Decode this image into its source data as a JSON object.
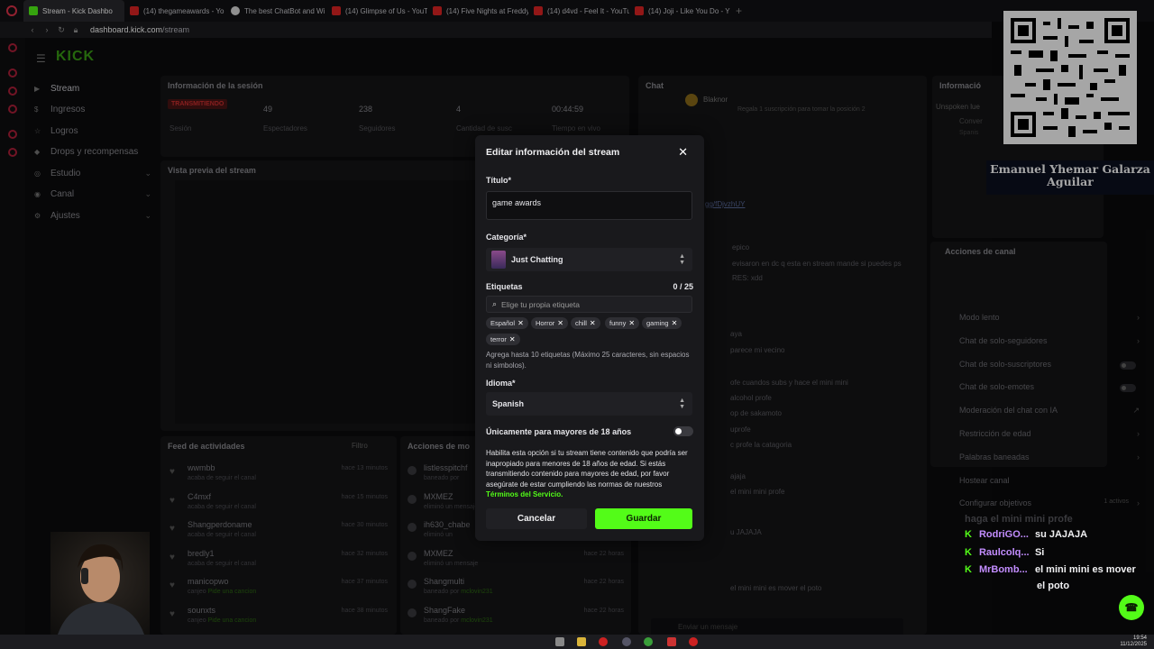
{
  "browser": {
    "tabs": [
      {
        "label": "Stream - Kick Dashbo",
        "icon": "kick",
        "active": true
      },
      {
        "label": "(14) thegameawards - Yo",
        "icon": "yt"
      },
      {
        "label": "The best ChatBot and Wi",
        "icon": "gpt"
      },
      {
        "label": "(14) Glimpse of Us - YouT",
        "icon": "yt"
      },
      {
        "label": "(14) Five Nights at Freddy",
        "icon": "yt"
      },
      {
        "label": "(14) d4vd - Feel It - YouTu",
        "icon": "yt"
      },
      {
        "label": "(14) Joji - Like You Do - Y",
        "icon": "yt"
      }
    ],
    "url_host": "dashboard.kick.com",
    "url_path": "/stream"
  },
  "sidebar": {
    "logo": "KICK",
    "items": [
      {
        "label": "Stream",
        "active": true
      },
      {
        "label": "Ingresos"
      },
      {
        "label": "Logros"
      },
      {
        "label": "Drops y recompensas"
      },
      {
        "label": "Estudio",
        "chevron": true
      },
      {
        "label": "Canal",
        "chevron": true
      },
      {
        "label": "Ajustes",
        "chevron": true
      }
    ]
  },
  "session": {
    "title": "Información de la sesión",
    "live_badge": "TRANSMITIENDO",
    "stats": [
      {
        "value": "",
        "label": "Sesión"
      },
      {
        "value": "49",
        "label": "Espectadores"
      },
      {
        "value": "238",
        "label": "Seguidores"
      },
      {
        "value": "4",
        "label": "Cantidad de susc"
      },
      {
        "value": "00:44:59",
        "label": "Tiempo en vivo"
      }
    ]
  },
  "preview": {
    "title": "Vista previa del stream"
  },
  "feed": {
    "title": "Feed de actividades",
    "filter": "Filtro",
    "rows": [
      {
        "name": "wwmbb",
        "sub": "acaba de seguir el canal",
        "time": "hace 13 minutos"
      },
      {
        "name": "C4mxf",
        "sub": "acaba de seguir el canal",
        "time": "hace 15 minutos"
      },
      {
        "name": "Shangperdoname",
        "sub": "acaba de seguir el canal",
        "time": "hace 30 minutos"
      },
      {
        "name": "bredly1",
        "sub": "acaba de seguir el canal",
        "time": "hace 32 minutos"
      },
      {
        "name": "manicopwo",
        "sub_prefix": "canjeo ",
        "sub_link": "Pide una cancion",
        "time": "hace 37 minutos"
      },
      {
        "name": "sounxts",
        "sub_prefix": "canjeo ",
        "sub_link": "Pide una cancion",
        "time": "hace 38 minutos"
      }
    ]
  },
  "mod_actions": {
    "title": "Acciones de mo",
    "rows": [
      {
        "name": "listlesspitchf",
        "sub_prefix": "baneado por ",
        "sub_link": "",
        "time": ""
      },
      {
        "name": "MXMEZ",
        "sub_prefix": "eliminó un mensaje",
        "sub_link": "",
        "time": ""
      },
      {
        "name": "ih630_chabe",
        "sub_prefix": "eliminó un ",
        "sub_link": "",
        "time": ""
      },
      {
        "name": "MXMEZ",
        "sub_prefix": "eliminó un mensaje",
        "sub_link": "",
        "time": "hace 22 horas"
      },
      {
        "name": "Shangmulti",
        "sub_prefix": "baneado por ",
        "sub_link": "mclovin231",
        "time": "hace 22 horas"
      },
      {
        "name": "ShangFake",
        "sub_prefix": "baneado por ",
        "sub_link": "mclovin231",
        "time": "hace 22 horas"
      }
    ]
  },
  "chat": {
    "title": "Chat",
    "pinned_user": "Blaknor",
    "pinned_note": "Regala 1 suscripción para tomar la posición 2",
    "pinned_link": "gg/fDjvzhUY",
    "lines": [
      "epico",
      "evisaron en dc q esta en stream mande si puedes ps",
      "RES: xdd",
      "aya",
      "parece mi vecino",
      "ofe cuandos subs y hace el mini mini",
      "alcohol profe",
      "op de sakamoto",
      "uprofe",
      "c profe la catagoria",
      "ajaja",
      "el mini mini profe",
      "u JAJAJA",
      "el mini mini es mover el poto"
    ],
    "input_placeholder": "Enviar un mensaje",
    "send_label": "Chat",
    "count": "0"
  },
  "channel_info": {
    "title": "Informació",
    "unspoken": "Unspoken lue",
    "conv": "Conver",
    "lang": "Spanis"
  },
  "channel_actions": {
    "title": "Acciones de canal",
    "items": [
      {
        "label": "Modo lento",
        "type": "chevron"
      },
      {
        "label": "Chat de solo-seguidores",
        "type": "chevron"
      },
      {
        "label": "Chat de solo-suscriptores",
        "type": "toggle"
      },
      {
        "label": "Chat de solo-emotes",
        "type": "toggle"
      },
      {
        "label": "Moderación del chat con IA",
        "type": "link"
      },
      {
        "label": "Restricción de edad",
        "type": "chevron"
      },
      {
        "label": "Palabras baneadas",
        "type": "chevron"
      },
      {
        "label": "Hostear canal",
        "type": "none"
      },
      {
        "label": "Configurar objetivos",
        "type": "status",
        "status": "1 activos"
      }
    ]
  },
  "modal": {
    "title": "Editar información del stream",
    "title_label": "Título*",
    "title_value": "game awards",
    "category_label": "Categoría*",
    "category_value": "Just Chatting",
    "tags_label": "Etiquetas",
    "tags_count": "0 / 25",
    "tags_placeholder": "Elige tu propia etiqueta",
    "tags": [
      "Español",
      "Horror",
      "chill",
      "funny",
      "gaming",
      "terror"
    ],
    "tags_help": "Agrega hasta 10 etiquetas (Máximo 25 caracteres, sin espacios ni simbolos).",
    "language_label": "Idioma*",
    "language_value": "Spanish",
    "adult_label": "Únicamente para mayores de 18 años",
    "adult_enabled": false,
    "adult_desc": "Habilita esta opción si tu stream tiene contenido que podría ser inapropiado para menores de 18 años de edad. Si estás transmitiendo contenido para mayores de edad, por favor asegúrate de estar cumpliendo las normas de nuestros",
    "adult_link": "Términos del Servicio.",
    "cancel_label": "Cancelar",
    "save_label": "Guardar"
  },
  "overlay": {
    "streamer_name": "Emanuel Yhemar Galarza Aguilar",
    "chat_ghost": "haga el mini mini profe",
    "chat": [
      {
        "user": "RodriGO...",
        "msg": "su JAJAJA"
      },
      {
        "user": "Raulcolq...",
        "msg": "Si"
      },
      {
        "user": "MrBomb...",
        "msg": "el mini mini es mover"
      },
      {
        "user": "",
        "msg": "el poto"
      }
    ]
  },
  "taskbar": {
    "time": "19:54",
    "date": "11/12/2025"
  },
  "colors": {
    "accent": "#53fc18",
    "live": "#d23030",
    "modal_bg": "#19191c"
  }
}
